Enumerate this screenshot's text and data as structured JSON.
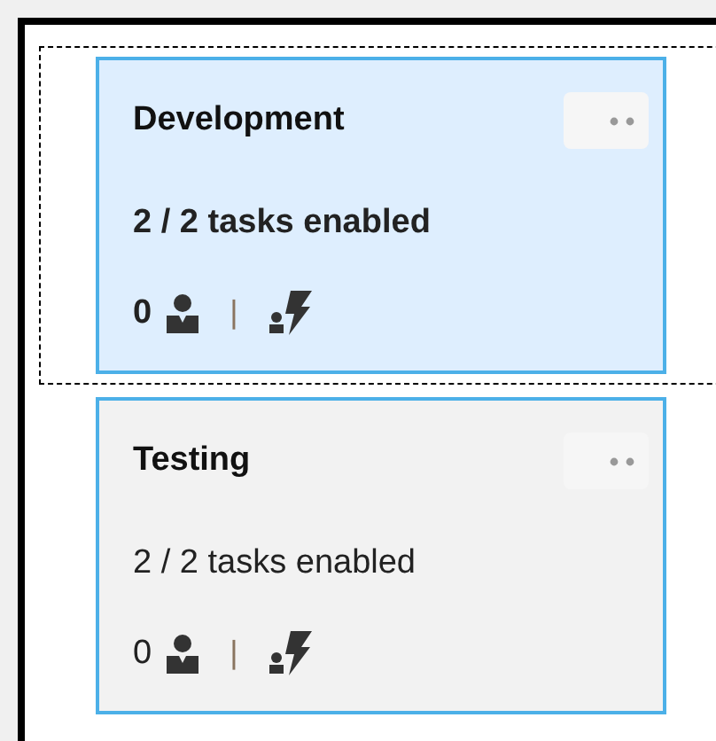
{
  "stages": [
    {
      "name": "Development",
      "selected": true,
      "tasks": "2 / 2 tasks enabled",
      "approvers": "0",
      "separator": "|"
    },
    {
      "name": "Testing",
      "selected": false,
      "tasks": "2 / 2 tasks enabled",
      "approvers": "0",
      "separator": "|"
    }
  ]
}
